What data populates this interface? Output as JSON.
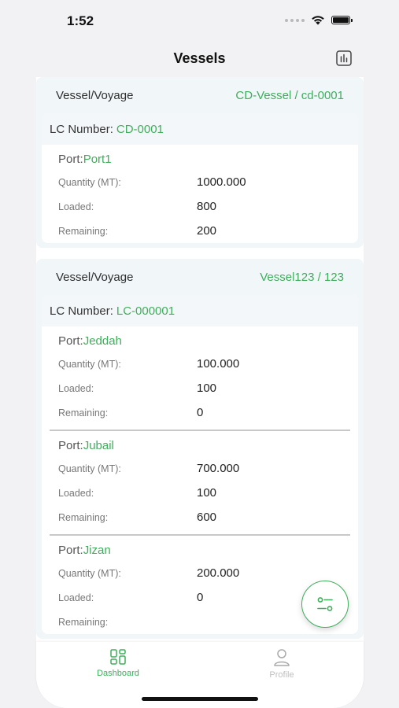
{
  "status_bar": {
    "time": "1:52"
  },
  "nav": {
    "title": "Vessels",
    "chart_icon": "bar-chart-icon"
  },
  "vessels": [
    {
      "label": "Vessel/Voyage",
      "value": "CD-Vessel / cd-0001",
      "lc_label": "LC Number:",
      "lc_value": "CD-0001",
      "ports": [
        {
          "port_label": "Port:",
          "name": "Port1",
          "qty_label": "Quantity (MT):",
          "qty": "1000.000",
          "loaded_label": "Loaded:",
          "loaded": "800",
          "remaining_label": "Remaining:",
          "remaining": "200"
        }
      ]
    },
    {
      "label": "Vessel/Voyage",
      "value": "Vessel123 / 123",
      "lc_label": "LC Number:",
      "lc_value": "LC-000001",
      "ports": [
        {
          "port_label": "Port:",
          "name": "Jeddah",
          "qty_label": "Quantity (MT):",
          "qty": "100.000",
          "loaded_label": "Loaded:",
          "loaded": "100",
          "remaining_label": "Remaining:",
          "remaining": "0"
        },
        {
          "port_label": "Port:",
          "name": "Jubail",
          "qty_label": "Quantity (MT):",
          "qty": "700.000",
          "loaded_label": "Loaded:",
          "loaded": "100",
          "remaining_label": "Remaining:",
          "remaining": "600"
        },
        {
          "port_label": "Port:",
          "name": "Jizan",
          "qty_label": "Quantity (MT):",
          "qty": "200.000",
          "loaded_label": "Loaded:",
          "loaded": "0",
          "remaining_label": "Remaining:",
          "remaining": ""
        }
      ]
    }
  ],
  "fab": {
    "icon": "filter-icon"
  },
  "tabs": [
    {
      "label": "Dashboard",
      "icon": "dashboard-icon"
    },
    {
      "label": "Profile",
      "icon": "profile-icon"
    }
  ],
  "colors": {
    "accent": "#3fae5c"
  }
}
